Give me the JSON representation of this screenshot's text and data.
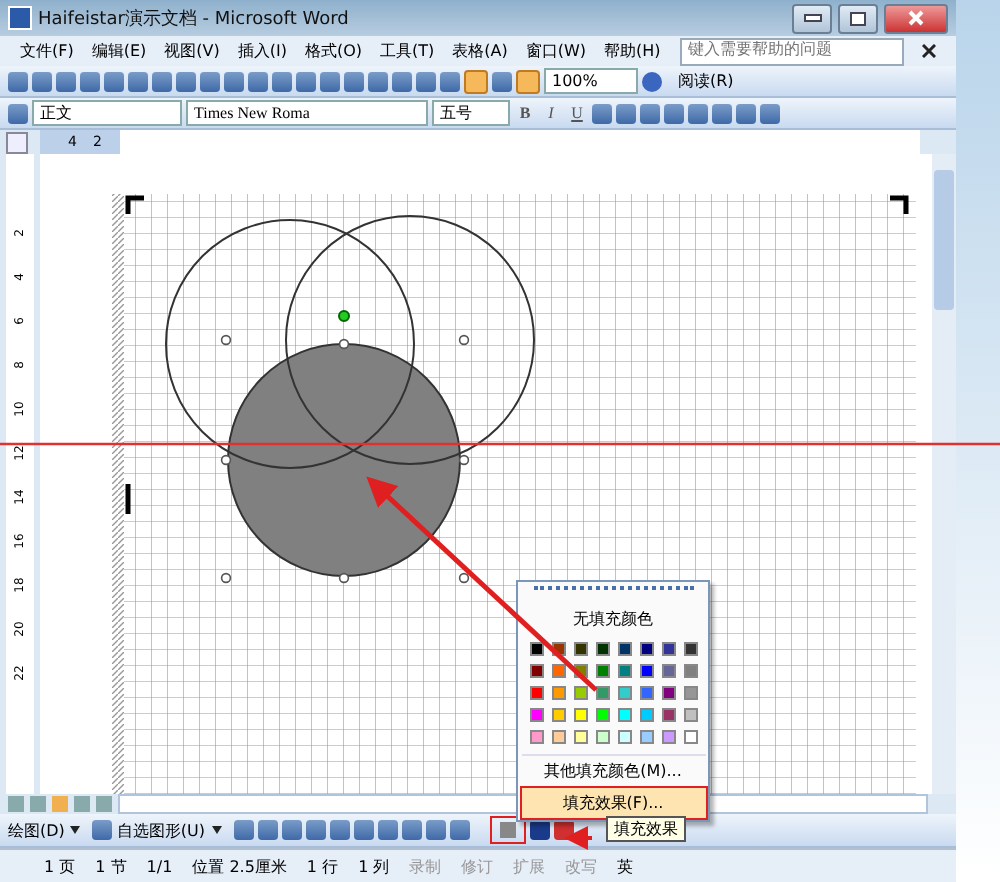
{
  "window": {
    "title": "Haifeistar演示文档 - Microsoft Word"
  },
  "menu_bar": [
    "文件(F)",
    "编辑(E)",
    "视图(V)",
    "插入(I)",
    "格式(O)",
    "工具(T)",
    "表格(A)",
    "窗口(W)",
    "帮助(H)"
  ],
  "help_box": {
    "placeholder": "键入需要帮助的问题"
  },
  "standard_toolbar": {
    "zoom": "100%",
    "read_button": "阅读(R)"
  },
  "format_toolbar": {
    "style": "正文",
    "font": "Times New Roma",
    "size": "五号",
    "bold": "B",
    "italic": "I",
    "underline": "U"
  },
  "ruler": {
    "horizontal": [
      "4",
      "2"
    ],
    "vertical": [
      "2",
      "4",
      "6",
      "8",
      "10",
      "12",
      "14",
      "16",
      "18",
      "20",
      "22"
    ]
  },
  "fill_menu": {
    "no_fill": "无填充颜色",
    "swatches": [
      {
        "color": "#000000"
      },
      {
        "color": "#993300"
      },
      {
        "color": "#333300"
      },
      {
        "color": "#003300"
      },
      {
        "color": "#003366"
      },
      {
        "color": "#000080"
      },
      {
        "color": "#333399"
      },
      {
        "color": "#333333"
      },
      {
        "color": "#800000"
      },
      {
        "color": "#ff6600"
      },
      {
        "color": "#808000"
      },
      {
        "color": "#008000"
      },
      {
        "color": "#008080"
      },
      {
        "color": "#0000ff"
      },
      {
        "color": "#666699"
      },
      {
        "color": "#808080"
      },
      {
        "color": "#ff0000"
      },
      {
        "color": "#ff9900"
      },
      {
        "color": "#99cc00"
      },
      {
        "color": "#339966"
      },
      {
        "color": "#33cccc"
      },
      {
        "color": "#3366ff"
      },
      {
        "color": "#800080"
      },
      {
        "color": "#969696"
      },
      {
        "color": "#ff00ff"
      },
      {
        "color": "#ffcc00"
      },
      {
        "color": "#ffff00"
      },
      {
        "color": "#00ff00"
      },
      {
        "color": "#00ffff"
      },
      {
        "color": "#00ccff"
      },
      {
        "color": "#993366"
      },
      {
        "color": "#c0c0c0"
      },
      {
        "color": "#ff99cc"
      },
      {
        "color": "#ffcc99"
      },
      {
        "color": "#ffff99"
      },
      {
        "color": "#ccffcc"
      },
      {
        "color": "#ccffff"
      },
      {
        "color": "#99ccff"
      },
      {
        "color": "#cc99ff"
      },
      {
        "color": "#ffffff"
      }
    ],
    "items": [
      {
        "label": "其他填充颜色(M)...",
        "selected": false
      },
      {
        "label": "填充效果(F)...",
        "selected": true
      }
    ]
  },
  "drawing_toolbar": {
    "draw_menu": "绘图(D)",
    "autoshapes_menu": "自选图形(U)",
    "fill_button_highlighted": true,
    "tooltip": "填充效果"
  },
  "status_bar": [
    "1 页",
    "1 节",
    "1/1",
    "位置 2.5厘米",
    "1 行",
    "1 列",
    "录制",
    "修订",
    "扩展",
    "改写",
    "英"
  ]
}
